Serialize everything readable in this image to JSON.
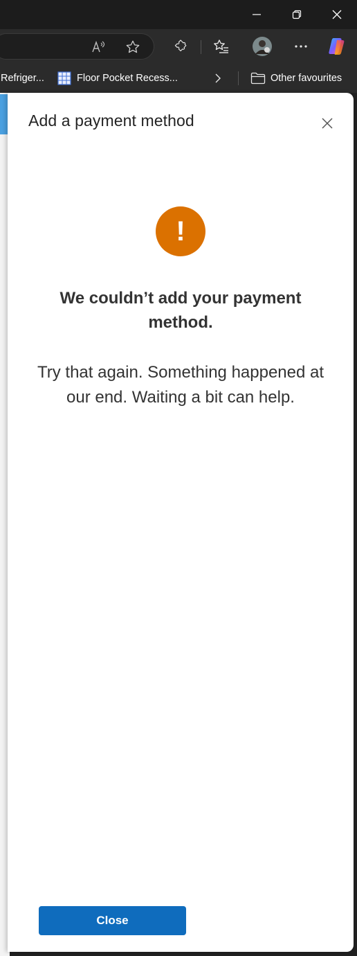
{
  "window_controls": {
    "minimize_icon": "minimize-icon",
    "restore_icon": "restore-icon",
    "close_icon": "close-icon"
  },
  "toolbar": {
    "read_aloud_icon": "read-aloud-icon",
    "favorite_icon": "star-icon",
    "extensions_icon": "extensions-icon",
    "favorites_list_icon": "favorites-icon",
    "profile_icon": "avatar",
    "more_icon": "more-icon",
    "copilot_icon": "copilot-icon"
  },
  "favourites_bar": {
    "items": [
      {
        "label": "Refriger..."
      },
      {
        "label": "Floor Pocket Recess..."
      }
    ],
    "other_label": "Other favourites"
  },
  "panel": {
    "title": "Add a payment method",
    "alert_mark": "!",
    "heading": "We couldn’t add your payment method.",
    "message": "Try that again. Something happened at our end. Waiting a bit can help.",
    "close_button_label": "Close",
    "accent_color": "#db7100",
    "button_color": "#0f6cbd"
  }
}
